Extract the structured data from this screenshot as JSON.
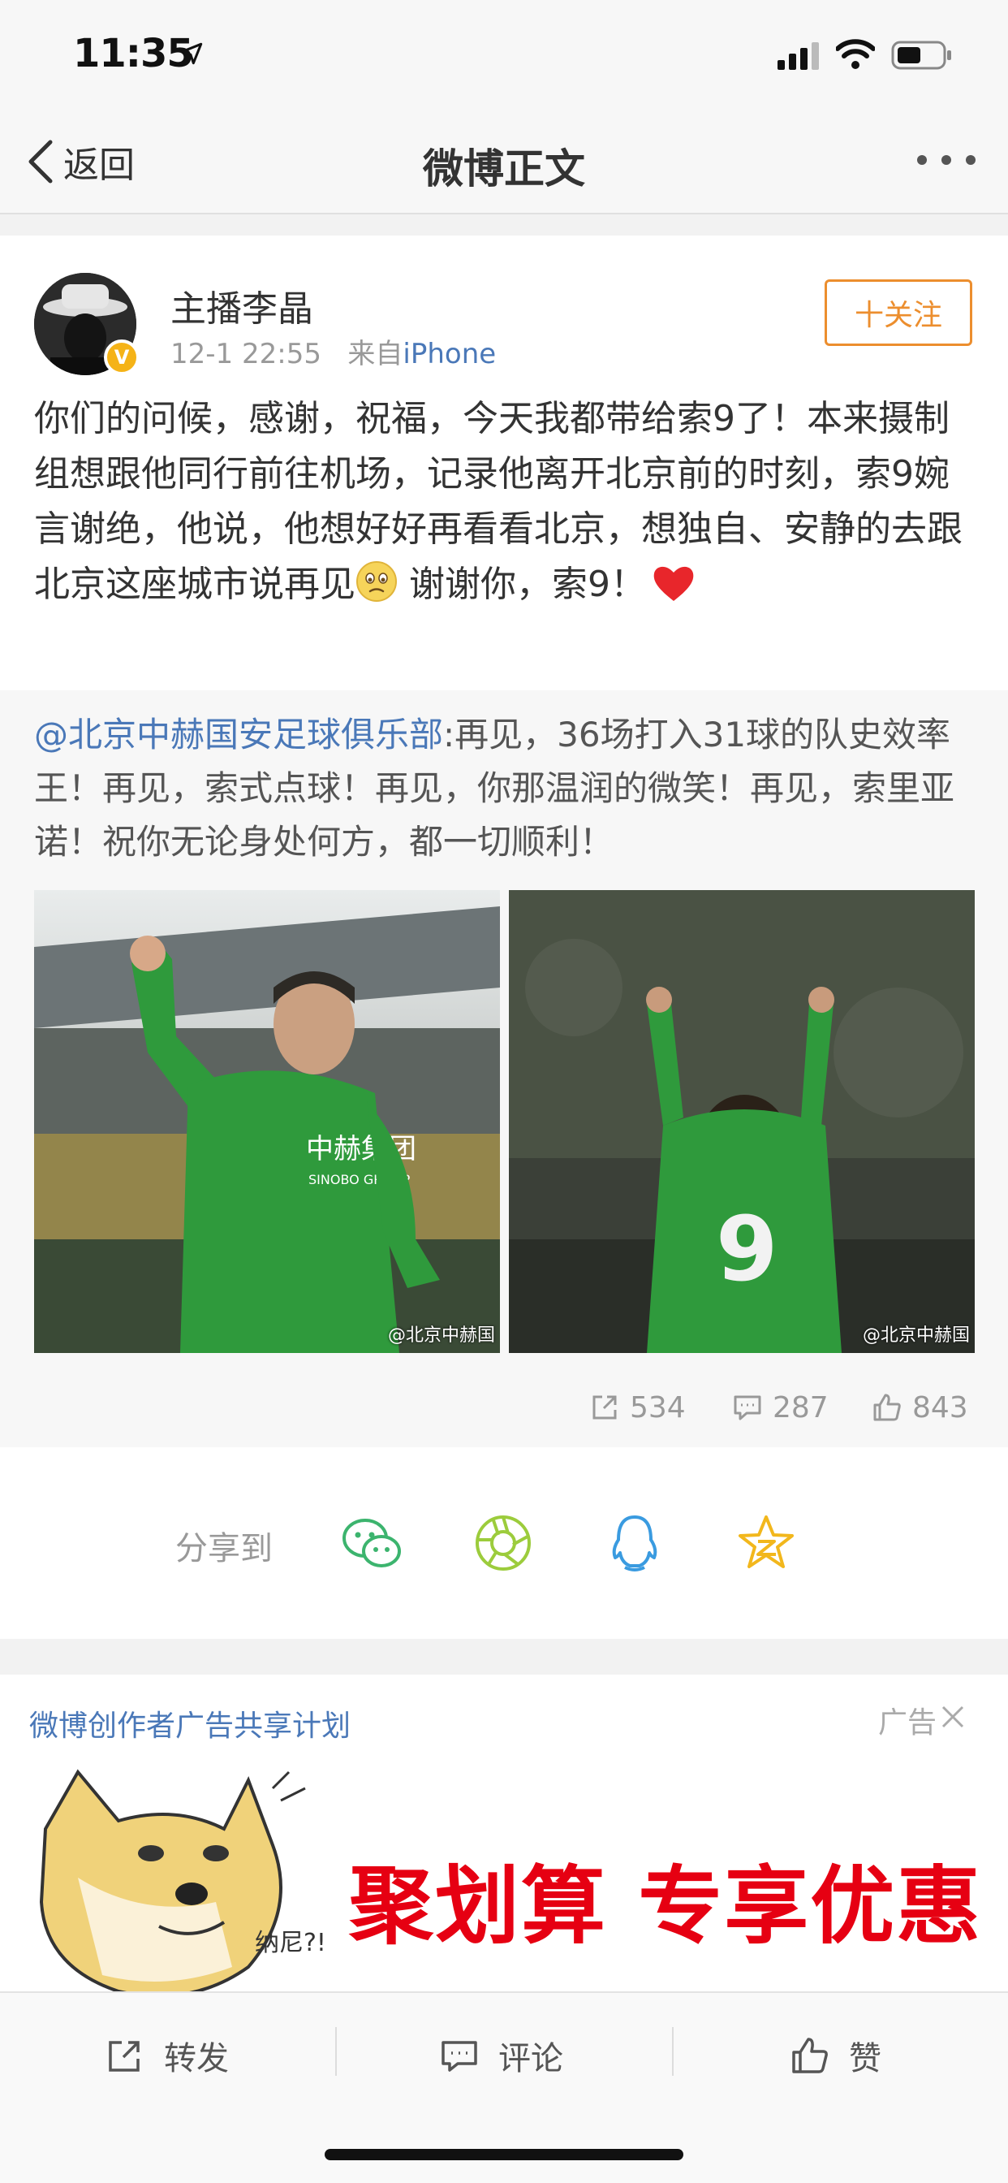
{
  "status_bar": {
    "time": "11:35"
  },
  "nav": {
    "back_label": "返回",
    "title": "微博正文"
  },
  "post": {
    "author": "主播李晶",
    "date": "12-1 22:55",
    "source_prefix": "来自",
    "source": "iPhone",
    "follow_label": "十关注",
    "text_part1": "你们的问候，感谢，祝福，今天我都带给索9了！本来摄制组想跟他同行前往机场，记录他离开北京前的时刻，索9婉言谢绝，他说，他想好好再看看北京，想独自、安静的去跟北京这座城市说再见",
    "text_part2": " 谢谢你，索9！",
    "repost": {
      "mention": "@北京中赫国安足球俱乐部",
      "text": ":再见，36场打入31球的队史效率王！再见，索式点球！再见，你那温润的微笑！再见，索里亚诺！祝你无论身处何方，都一切顺利！",
      "image_left_watermark": "@北京中赫国",
      "image_right_watermark": "@北京中赫国",
      "image_left_shirt": "中赫集团",
      "image_left_shirt_en": "SINOBO GROUP",
      "image_right_number": "9"
    },
    "stats": {
      "reposts": "534",
      "comments": "287",
      "likes": "843"
    }
  },
  "share": {
    "label": "分享到",
    "icons": [
      "wechat-icon",
      "moments-icon",
      "qq-icon",
      "qzone-icon"
    ]
  },
  "ad": {
    "title": "微博创作者广告共享计划",
    "tag": "广告",
    "doge_text": "纳尼?!",
    "banner": "聚划算 专享优惠"
  },
  "bottom_bar": {
    "repost": "转发",
    "comment": "评论",
    "like": "赞"
  },
  "colors": {
    "accent_orange": "#ec8e2e",
    "link_blue": "#4a78b8",
    "ad_red": "#e60012"
  }
}
